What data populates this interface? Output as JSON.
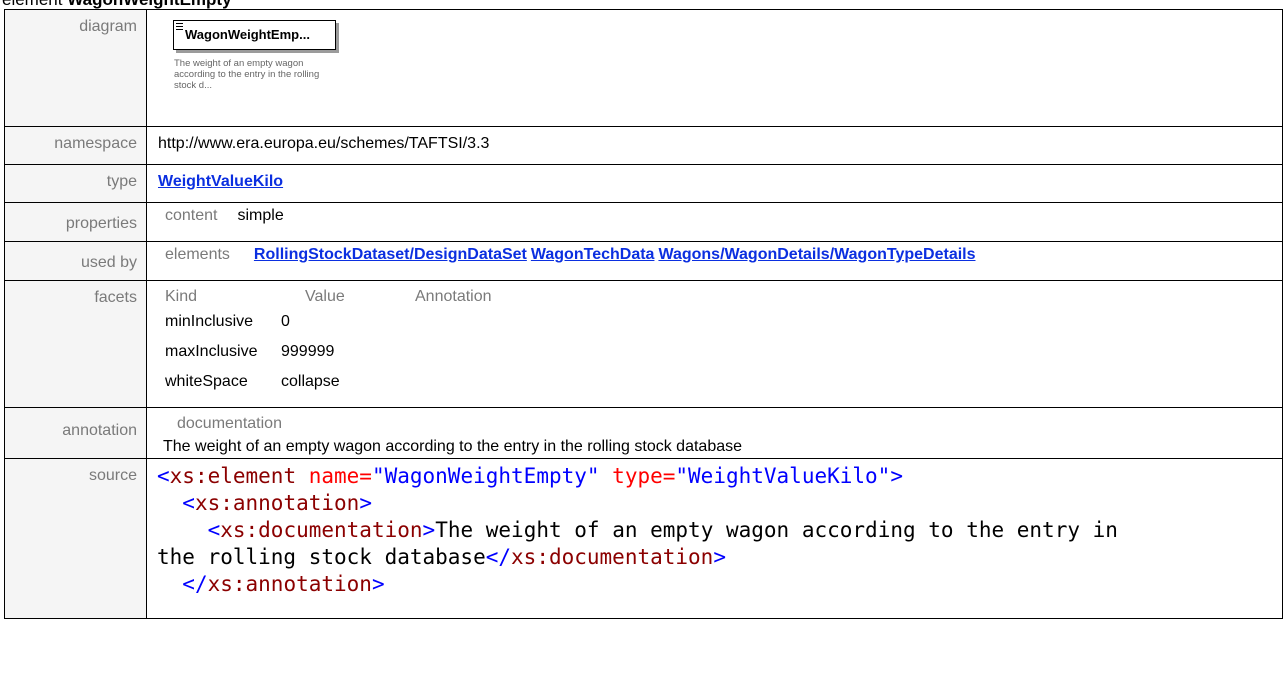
{
  "heading": {
    "prefix": "element",
    "name": "WagonWeightEmpty"
  },
  "labels": {
    "diagram": "diagram",
    "namespace": "namespace",
    "type": "type",
    "properties": "properties",
    "used_by": "used by",
    "facets": "facets",
    "annotation": "annotation",
    "source": "source"
  },
  "diagram": {
    "box_name": "WagonWeightEmp...",
    "note": "The weight of an empty wagon according to the entry in the rolling stock d..."
  },
  "namespace": "http://www.era.europa.eu/schemes/TAFTSI/3.3",
  "type_link": "WeightValueKilo",
  "properties": {
    "key": "content",
    "value": "simple"
  },
  "used_by": {
    "kind": "elements",
    "links": [
      "RollingStockDataset/DesignDataSet",
      "WagonTechData",
      "Wagons/WagonDetails/WagonTypeDetails"
    ]
  },
  "facets": {
    "headers": [
      "Kind",
      "Value",
      "Annotation"
    ],
    "rows": [
      {
        "kind": "minInclusive",
        "value": "0"
      },
      {
        "kind": "maxInclusive",
        "value": "999999"
      },
      {
        "kind": "whiteSpace",
        "value": "collapse"
      }
    ]
  },
  "annotation": {
    "header": "documentation",
    "text": "The weight of an empty wagon according to the entry in the rolling stock database"
  },
  "source": {
    "line1": {
      "open": "<",
      "tag": "xs:element",
      "a1": " name=",
      "v1": "\"WagonWeightEmpty\"",
      "a2": " type=",
      "v2": "\"WeightValueKilo\"",
      "close": ">"
    },
    "line2": {
      "indent": "  ",
      "open": "<",
      "tag": "xs:annotation",
      "close": ">"
    },
    "line3": {
      "indent": "    ",
      "open": "<",
      "tag": "xs:documentation",
      "close": ">",
      "text": "The weight of an empty wagon according to the entry in"
    },
    "line4": {
      "text": "the rolling stock database",
      "open": "</",
      "tag": "xs:documentation",
      "close": ">"
    },
    "line5": {
      "indent": "  ",
      "open": "</",
      "tag": "xs:annotation",
      "close": ">"
    }
  },
  "colors": {
    "link": "#0b2fe0",
    "label_bg": "#f5f5f5",
    "label_text": "#7a7a7a",
    "xml_tag": "#8b0000",
    "xml_attr": "#ff0000",
    "xml_bracket": "#0000ff"
  }
}
